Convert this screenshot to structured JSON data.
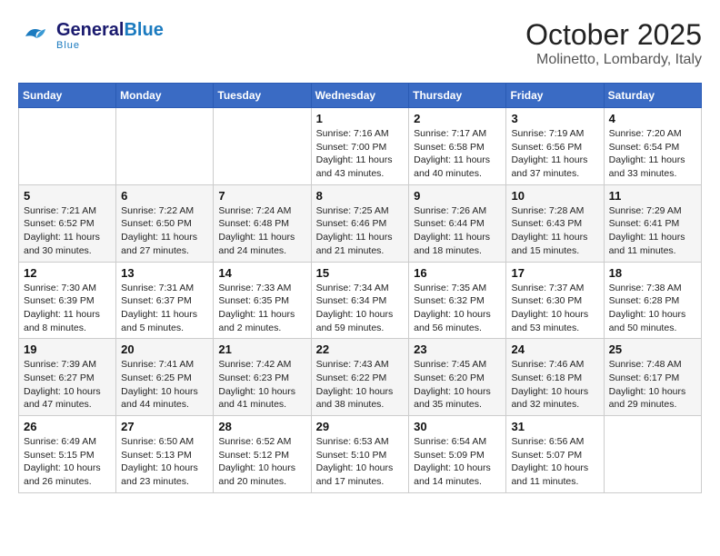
{
  "header": {
    "logo_general": "General",
    "logo_blue": "Blue",
    "month_year": "October 2025",
    "location": "Molinetto, Lombardy, Italy"
  },
  "calendar": {
    "days_of_week": [
      "Sunday",
      "Monday",
      "Tuesday",
      "Wednesday",
      "Thursday",
      "Friday",
      "Saturday"
    ],
    "weeks": [
      [
        {
          "day": "",
          "info": ""
        },
        {
          "day": "",
          "info": ""
        },
        {
          "day": "",
          "info": ""
        },
        {
          "day": "1",
          "info": "Sunrise: 7:16 AM\nSunset: 7:00 PM\nDaylight: 11 hours\nand 43 minutes."
        },
        {
          "day": "2",
          "info": "Sunrise: 7:17 AM\nSunset: 6:58 PM\nDaylight: 11 hours\nand 40 minutes."
        },
        {
          "day": "3",
          "info": "Sunrise: 7:19 AM\nSunset: 6:56 PM\nDaylight: 11 hours\nand 37 minutes."
        },
        {
          "day": "4",
          "info": "Sunrise: 7:20 AM\nSunset: 6:54 PM\nDaylight: 11 hours\nand 33 minutes."
        }
      ],
      [
        {
          "day": "5",
          "info": "Sunrise: 7:21 AM\nSunset: 6:52 PM\nDaylight: 11 hours\nand 30 minutes."
        },
        {
          "day": "6",
          "info": "Sunrise: 7:22 AM\nSunset: 6:50 PM\nDaylight: 11 hours\nand 27 minutes."
        },
        {
          "day": "7",
          "info": "Sunrise: 7:24 AM\nSunset: 6:48 PM\nDaylight: 11 hours\nand 24 minutes."
        },
        {
          "day": "8",
          "info": "Sunrise: 7:25 AM\nSunset: 6:46 PM\nDaylight: 11 hours\nand 21 minutes."
        },
        {
          "day": "9",
          "info": "Sunrise: 7:26 AM\nSunset: 6:44 PM\nDaylight: 11 hours\nand 18 minutes."
        },
        {
          "day": "10",
          "info": "Sunrise: 7:28 AM\nSunset: 6:43 PM\nDaylight: 11 hours\nand 15 minutes."
        },
        {
          "day": "11",
          "info": "Sunrise: 7:29 AM\nSunset: 6:41 PM\nDaylight: 11 hours\nand 11 minutes."
        }
      ],
      [
        {
          "day": "12",
          "info": "Sunrise: 7:30 AM\nSunset: 6:39 PM\nDaylight: 11 hours\nand 8 minutes."
        },
        {
          "day": "13",
          "info": "Sunrise: 7:31 AM\nSunset: 6:37 PM\nDaylight: 11 hours\nand 5 minutes."
        },
        {
          "day": "14",
          "info": "Sunrise: 7:33 AM\nSunset: 6:35 PM\nDaylight: 11 hours\nand 2 minutes."
        },
        {
          "day": "15",
          "info": "Sunrise: 7:34 AM\nSunset: 6:34 PM\nDaylight: 10 hours\nand 59 minutes."
        },
        {
          "day": "16",
          "info": "Sunrise: 7:35 AM\nSunset: 6:32 PM\nDaylight: 10 hours\nand 56 minutes."
        },
        {
          "day": "17",
          "info": "Sunrise: 7:37 AM\nSunset: 6:30 PM\nDaylight: 10 hours\nand 53 minutes."
        },
        {
          "day": "18",
          "info": "Sunrise: 7:38 AM\nSunset: 6:28 PM\nDaylight: 10 hours\nand 50 minutes."
        }
      ],
      [
        {
          "day": "19",
          "info": "Sunrise: 7:39 AM\nSunset: 6:27 PM\nDaylight: 10 hours\nand 47 minutes."
        },
        {
          "day": "20",
          "info": "Sunrise: 7:41 AM\nSunset: 6:25 PM\nDaylight: 10 hours\nand 44 minutes."
        },
        {
          "day": "21",
          "info": "Sunrise: 7:42 AM\nSunset: 6:23 PM\nDaylight: 10 hours\nand 41 minutes."
        },
        {
          "day": "22",
          "info": "Sunrise: 7:43 AM\nSunset: 6:22 PM\nDaylight: 10 hours\nand 38 minutes."
        },
        {
          "day": "23",
          "info": "Sunrise: 7:45 AM\nSunset: 6:20 PM\nDaylight: 10 hours\nand 35 minutes."
        },
        {
          "day": "24",
          "info": "Sunrise: 7:46 AM\nSunset: 6:18 PM\nDaylight: 10 hours\nand 32 minutes."
        },
        {
          "day": "25",
          "info": "Sunrise: 7:48 AM\nSunset: 6:17 PM\nDaylight: 10 hours\nand 29 minutes."
        }
      ],
      [
        {
          "day": "26",
          "info": "Sunrise: 6:49 AM\nSunset: 5:15 PM\nDaylight: 10 hours\nand 26 minutes."
        },
        {
          "day": "27",
          "info": "Sunrise: 6:50 AM\nSunset: 5:13 PM\nDaylight: 10 hours\nand 23 minutes."
        },
        {
          "day": "28",
          "info": "Sunrise: 6:52 AM\nSunset: 5:12 PM\nDaylight: 10 hours\nand 20 minutes."
        },
        {
          "day": "29",
          "info": "Sunrise: 6:53 AM\nSunset: 5:10 PM\nDaylight: 10 hours\nand 17 minutes."
        },
        {
          "day": "30",
          "info": "Sunrise: 6:54 AM\nSunset: 5:09 PM\nDaylight: 10 hours\nand 14 minutes."
        },
        {
          "day": "31",
          "info": "Sunrise: 6:56 AM\nSunset: 5:07 PM\nDaylight: 10 hours\nand 11 minutes."
        },
        {
          "day": "",
          "info": ""
        }
      ]
    ]
  }
}
